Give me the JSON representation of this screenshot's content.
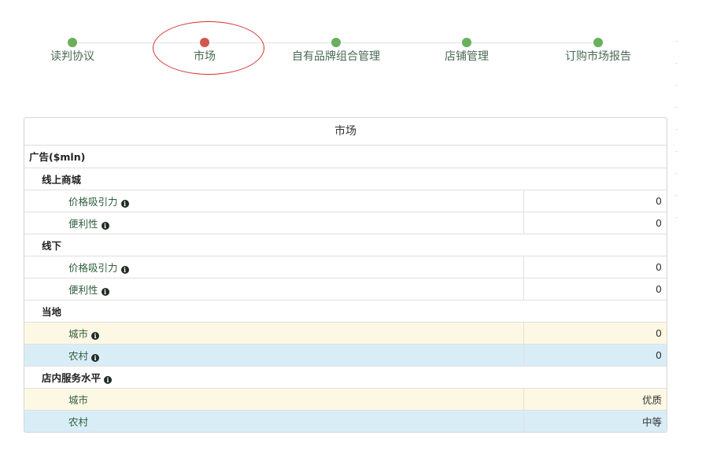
{
  "steps": [
    {
      "label": "读判协议",
      "state": "done"
    },
    {
      "label": "市场",
      "state": "current"
    },
    {
      "label": "自有品牌组合管理",
      "state": "done"
    },
    {
      "label": "店铺管理",
      "state": "done"
    },
    {
      "label": "订购市场报告",
      "state": "done"
    }
  ],
  "colors": {
    "step_done": "#6aaf5c",
    "step_current": "#d0574d",
    "highlight_ring": "#d2332c",
    "row_amber": "#fcf8e3",
    "row_blue": "#d9edf7"
  },
  "panel": {
    "title": "市场",
    "sections": {
      "advertising": {
        "label": "广告($mln)",
        "online": {
          "label": "线上商城",
          "price_appeal": {
            "label": "价格吸引力",
            "value": "0"
          },
          "convenience": {
            "label": "便利性",
            "value": "0"
          }
        },
        "offline": {
          "label": "线下",
          "price_appeal": {
            "label": "价格吸引力",
            "value": "0"
          },
          "convenience": {
            "label": "便利性",
            "value": "0"
          }
        },
        "local": {
          "label": "当地",
          "city": {
            "label": "城市",
            "value": "0"
          },
          "rural": {
            "label": "农村",
            "value": "0"
          }
        }
      },
      "service": {
        "label": "店内服务水平",
        "city": {
          "label": "城市",
          "value": "优质"
        },
        "rural": {
          "label": "农村",
          "value": "中等"
        }
      }
    }
  },
  "icons": {
    "info": "info-circle-icon"
  }
}
